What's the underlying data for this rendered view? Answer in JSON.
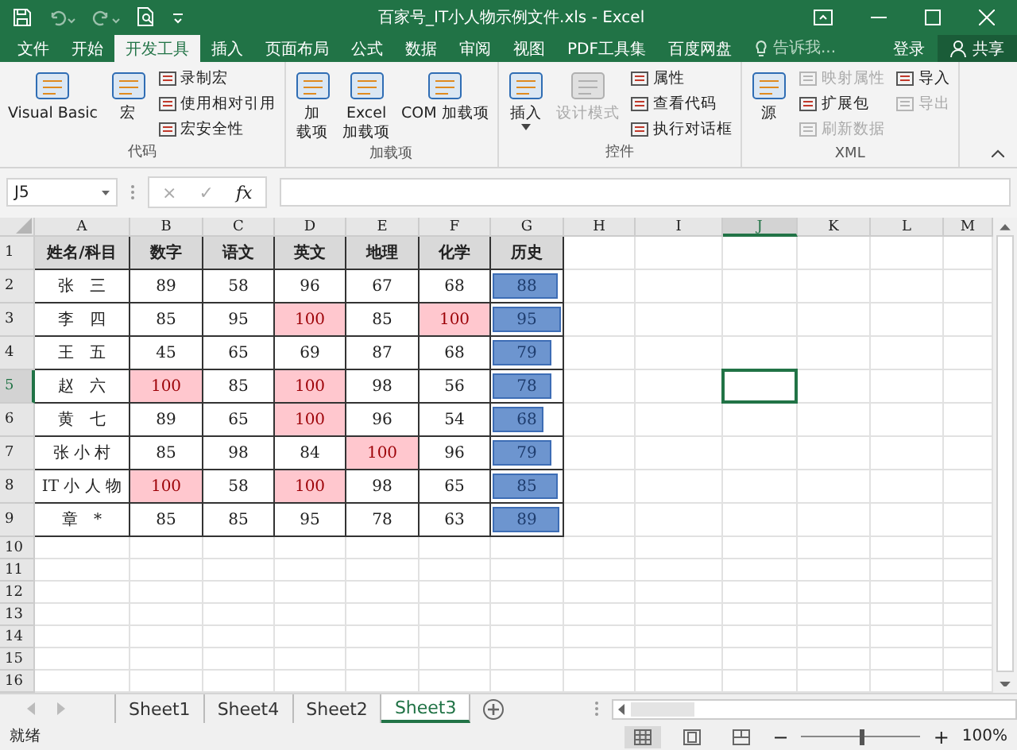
{
  "window": {
    "title": "百家号_IT小人物示例文件.xls - Excel"
  },
  "menu_tabs": [
    {
      "label": "文件",
      "selected": false
    },
    {
      "label": "开始",
      "selected": false
    },
    {
      "label": "开发工具",
      "selected": true
    },
    {
      "label": "插入",
      "selected": false
    },
    {
      "label": "页面布局",
      "selected": false
    },
    {
      "label": "公式",
      "selected": false
    },
    {
      "label": "数据",
      "selected": false
    },
    {
      "label": "审阅",
      "selected": false
    },
    {
      "label": "视图",
      "selected": false
    },
    {
      "label": "PDF工具集",
      "selected": false
    },
    {
      "label": "百度网盘",
      "selected": false
    }
  ],
  "tell_me": {
    "placeholder": "告诉我..."
  },
  "account": {
    "login": "登录",
    "share": "共享"
  },
  "ribbon": {
    "groups": [
      {
        "label": "代码",
        "items": [
          {
            "kind": "large",
            "lines": [
              "Visual Basic"
            ],
            "disabled": false,
            "caret": false
          },
          {
            "kind": "large",
            "lines": [
              "宏"
            ],
            "disabled": false,
            "caret": false
          },
          {
            "kind": "stack",
            "items": [
              {
                "label": "录制宏",
                "disabled": false
              },
              {
                "label": "使用相对引用",
                "disabled": false
              },
              {
                "label": "宏安全性",
                "disabled": false
              }
            ]
          }
        ]
      },
      {
        "label": "加载项",
        "items": [
          {
            "kind": "large",
            "lines": [
              "加",
              "载项"
            ],
            "disabled": false,
            "caret": false
          },
          {
            "kind": "large",
            "lines": [
              "Excel",
              "加载项"
            ],
            "disabled": false,
            "caret": false
          },
          {
            "kind": "large",
            "lines": [
              "COM 加载项"
            ],
            "disabled": false,
            "caret": false
          }
        ]
      },
      {
        "label": "控件",
        "items": [
          {
            "kind": "large",
            "lines": [
              "插入"
            ],
            "disabled": false,
            "caret": true
          },
          {
            "kind": "large",
            "lines": [
              "设计模式"
            ],
            "disabled": true,
            "caret": false
          },
          {
            "kind": "stack",
            "items": [
              {
                "label": "属性",
                "disabled": false
              },
              {
                "label": "查看代码",
                "disabled": false
              },
              {
                "label": "执行对话框",
                "disabled": false
              }
            ]
          }
        ]
      },
      {
        "label": "XML",
        "items": [
          {
            "kind": "large",
            "lines": [
              "源"
            ],
            "disabled": false,
            "caret": false
          },
          {
            "kind": "stack",
            "items": [
              {
                "label": "映射属性",
                "disabled": true
              },
              {
                "label": "扩展包",
                "disabled": false
              },
              {
                "label": "刷新数据",
                "disabled": true
              }
            ]
          },
          {
            "kind": "stack",
            "items": [
              {
                "label": "导入",
                "disabled": false
              },
              {
                "label": "导出",
                "disabled": true
              }
            ]
          }
        ]
      }
    ]
  },
  "formula_bar": {
    "name_box": "J5",
    "cancel": "×",
    "enter": "✓",
    "fx": "fx"
  },
  "sheet": {
    "columns": [
      {
        "label": "A",
        "selected": false
      },
      {
        "label": "B",
        "selected": false
      },
      {
        "label": "C",
        "selected": false
      },
      {
        "label": "D",
        "selected": false
      },
      {
        "label": "E",
        "selected": false
      },
      {
        "label": "F",
        "selected": false
      },
      {
        "label": "G",
        "selected": false
      },
      {
        "label": "H",
        "selected": false
      },
      {
        "label": "I",
        "selected": false
      },
      {
        "label": "J",
        "selected": true
      },
      {
        "label": "K",
        "selected": false
      },
      {
        "label": "L",
        "selected": false
      },
      {
        "label": "M",
        "selected": false
      }
    ],
    "rows": [
      {
        "number": "1",
        "selected": false,
        "cells": [
          {
            "kind": "header",
            "text": "姓名/科目"
          },
          {
            "kind": "header",
            "text": "数字"
          },
          {
            "kind": "header",
            "text": "语文"
          },
          {
            "kind": "header",
            "text": "英文"
          },
          {
            "kind": "header",
            "text": "地理"
          },
          {
            "kind": "header",
            "text": "化学"
          },
          {
            "kind": "header",
            "text": "历史"
          }
        ]
      },
      {
        "number": "2",
        "selected": false,
        "cells": [
          {
            "kind": "name",
            "text": "张　三"
          },
          {
            "kind": "number",
            "text": "89",
            "highlight": false
          },
          {
            "kind": "number",
            "text": "58",
            "highlight": false
          },
          {
            "kind": "number",
            "text": "96",
            "highlight": false
          },
          {
            "kind": "number",
            "text": "67",
            "highlight": false
          },
          {
            "kind": "number",
            "text": "68",
            "highlight": false
          },
          {
            "kind": "bar",
            "text": "88",
            "level": 0.92
          }
        ]
      },
      {
        "number": "3",
        "selected": false,
        "cells": [
          {
            "kind": "name",
            "text": "李　四"
          },
          {
            "kind": "number",
            "text": "85",
            "highlight": false
          },
          {
            "kind": "number",
            "text": "95",
            "highlight": false
          },
          {
            "kind": "number",
            "text": "100",
            "highlight": true
          },
          {
            "kind": "number",
            "text": "85",
            "highlight": false
          },
          {
            "kind": "number",
            "text": "100",
            "highlight": true
          },
          {
            "kind": "bar",
            "text": "95",
            "level": 1
          }
        ]
      },
      {
        "number": "4",
        "selected": false,
        "cells": [
          {
            "kind": "name",
            "text": "王　五"
          },
          {
            "kind": "number",
            "text": "45",
            "highlight": false
          },
          {
            "kind": "number",
            "text": "65",
            "highlight": false
          },
          {
            "kind": "number",
            "text": "69",
            "highlight": false
          },
          {
            "kind": "number",
            "text": "87",
            "highlight": false
          },
          {
            "kind": "number",
            "text": "68",
            "highlight": false
          },
          {
            "kind": "bar",
            "text": "79",
            "level": 0.83
          }
        ]
      },
      {
        "number": "5",
        "selected": true,
        "cells": [
          {
            "kind": "name",
            "text": "赵　六"
          },
          {
            "kind": "number",
            "text": "100",
            "highlight": true
          },
          {
            "kind": "number",
            "text": "85",
            "highlight": false
          },
          {
            "kind": "number",
            "text": "100",
            "highlight": true
          },
          {
            "kind": "number",
            "text": "98",
            "highlight": false
          },
          {
            "kind": "number",
            "text": "56",
            "highlight": false
          },
          {
            "kind": "bar",
            "text": "78",
            "level": 0.82
          }
        ]
      },
      {
        "number": "6",
        "selected": false,
        "cells": [
          {
            "kind": "name",
            "text": "黄　七"
          },
          {
            "kind": "number",
            "text": "89",
            "highlight": false
          },
          {
            "kind": "number",
            "text": "65",
            "highlight": false
          },
          {
            "kind": "number",
            "text": "100",
            "highlight": true
          },
          {
            "kind": "number",
            "text": "96",
            "highlight": false
          },
          {
            "kind": "number",
            "text": "54",
            "highlight": false
          },
          {
            "kind": "bar",
            "text": "68",
            "level": 0.72
          }
        ]
      },
      {
        "number": "7",
        "selected": false,
        "cells": [
          {
            "kind": "name",
            "text": "张 小 村"
          },
          {
            "kind": "number",
            "text": "85",
            "highlight": false
          },
          {
            "kind": "number",
            "text": "98",
            "highlight": false
          },
          {
            "kind": "number",
            "text": "84",
            "highlight": false
          },
          {
            "kind": "number",
            "text": "100",
            "highlight": true
          },
          {
            "kind": "number",
            "text": "96",
            "highlight": false
          },
          {
            "kind": "bar",
            "text": "79",
            "level": 0.83
          }
        ]
      },
      {
        "number": "8",
        "selected": false,
        "cells": [
          {
            "kind": "name",
            "text": "IT 小 人 物"
          },
          {
            "kind": "number",
            "text": "100",
            "highlight": true
          },
          {
            "kind": "number",
            "text": "58",
            "highlight": false
          },
          {
            "kind": "number",
            "text": "100",
            "highlight": true
          },
          {
            "kind": "number",
            "text": "98",
            "highlight": false
          },
          {
            "kind": "number",
            "text": "65",
            "highlight": false
          },
          {
            "kind": "bar",
            "text": "85",
            "level": 0.9
          }
        ]
      },
      {
        "number": "9",
        "selected": false,
        "cells": [
          {
            "kind": "name",
            "text": "章　*"
          },
          {
            "kind": "number",
            "text": "85",
            "highlight": false
          },
          {
            "kind": "number",
            "text": "85",
            "highlight": false
          },
          {
            "kind": "number",
            "text": "95",
            "highlight": false
          },
          {
            "kind": "number",
            "text": "78",
            "highlight": false
          },
          {
            "kind": "number",
            "text": "63",
            "highlight": false
          },
          {
            "kind": "bar",
            "text": "89",
            "level": 0.94
          }
        ]
      },
      {
        "number": "10",
        "selected": false,
        "cells": []
      },
      {
        "number": "11",
        "selected": false,
        "cells": []
      },
      {
        "number": "12",
        "selected": false,
        "cells": []
      },
      {
        "number": "13",
        "selected": false,
        "cells": []
      },
      {
        "number": "14",
        "selected": false,
        "cells": []
      },
      {
        "number": "15",
        "selected": false,
        "cells": []
      },
      {
        "number": "16",
        "selected": false,
        "cells": []
      }
    ]
  },
  "sheet_tabs": [
    {
      "label": "Sheet1",
      "selected": false
    },
    {
      "label": "Sheet4",
      "selected": false
    },
    {
      "label": "Sheet2",
      "selected": false
    },
    {
      "label": "Sheet3",
      "selected": true
    }
  ],
  "status_bar": {
    "status": "就绪",
    "zoom_out": "−",
    "zoom_in": "+",
    "zoom": "100%",
    "zoom_slider": {
      "level": 0.5
    },
    "views": [
      {
        "selected": true
      },
      {
        "selected": false
      },
      {
        "selected": false
      }
    ]
  }
}
